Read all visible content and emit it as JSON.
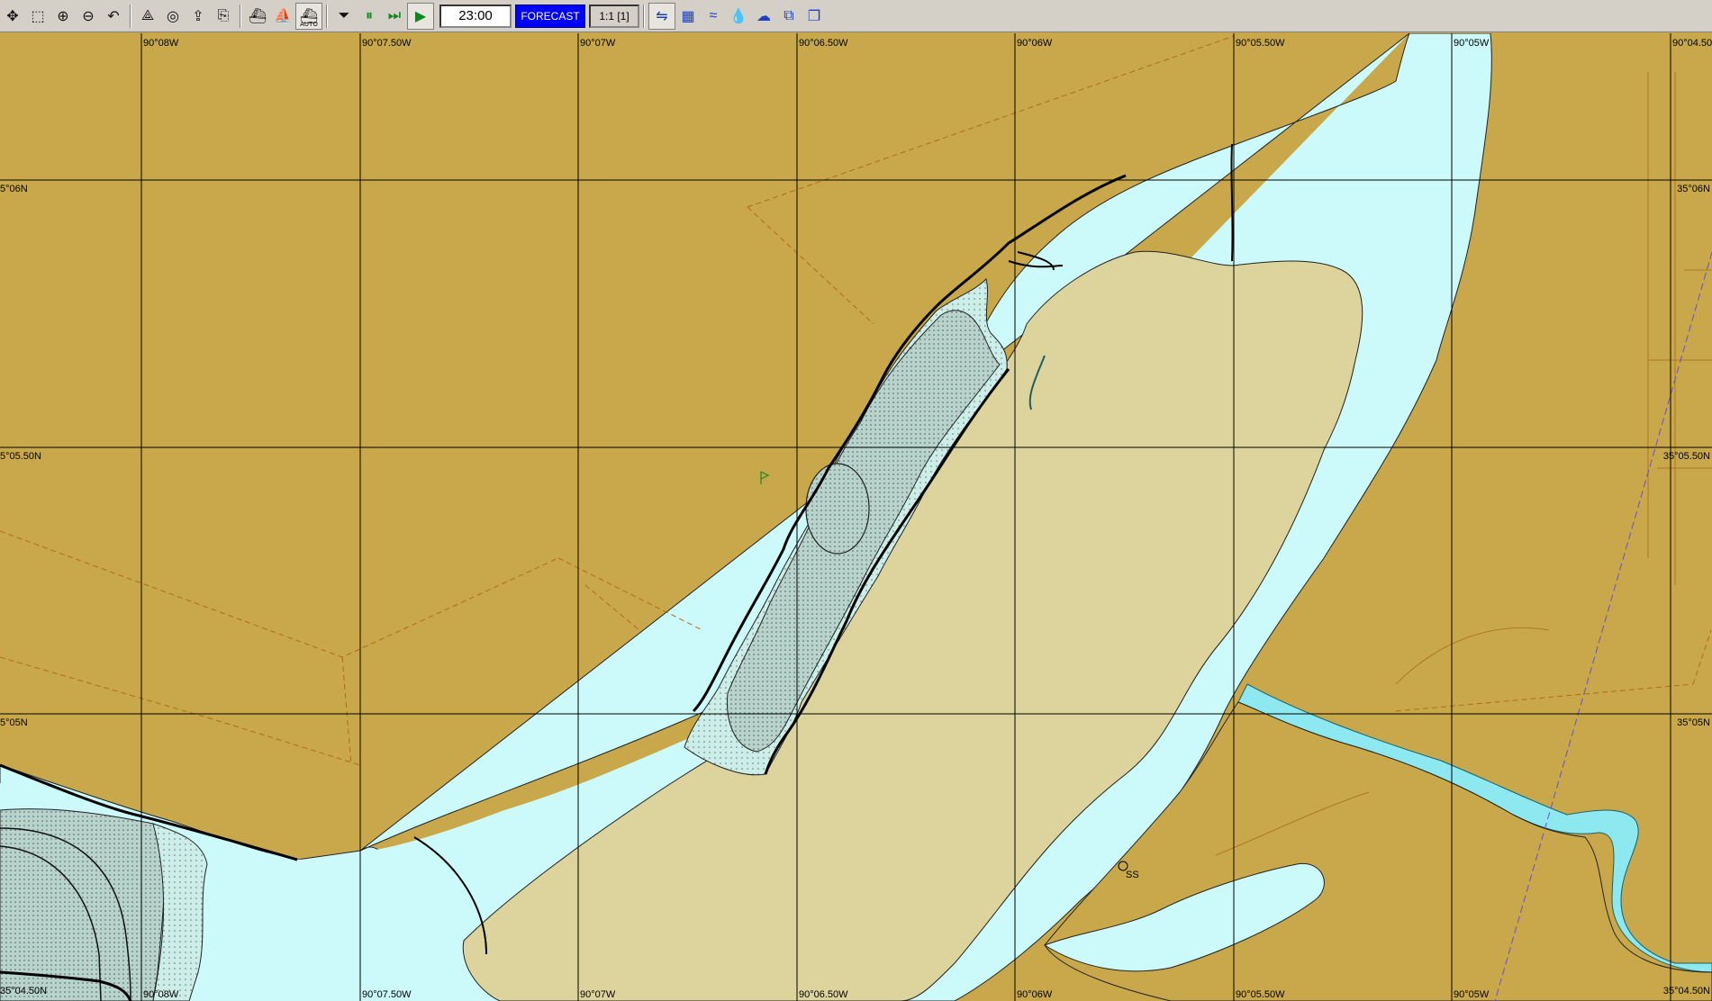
{
  "toolbar": {
    "time": "23:00",
    "forecast_label": "FORECAST",
    "scale_label": "1:1 [1]",
    "auto_label": "AUTO",
    "icons": [
      "pan-icon",
      "zoom-box-icon",
      "zoom-in-icon",
      "zoom-out-icon",
      "undo-icon",
      "route-icon",
      "target-icon",
      "export-icon",
      "import-icon",
      "ship-icon",
      "ship-small-icon",
      "ship-auto-icon",
      "step-down-icon",
      "pause-icon",
      "fast-forward-icon",
      "play-icon",
      "tide-icon",
      "grid-icon",
      "current-icon",
      "water-icon",
      "weather-icon",
      "layers-icon",
      "windows-icon"
    ]
  },
  "chart": {
    "longitude_labels_top": [
      "90°08W",
      "90°07.50W",
      "90°07W",
      "90°06.50W",
      "90°06W",
      "90°05.50W",
      "90°05W",
      "90°04.50"
    ],
    "longitude_labels_bottom": [
      "90°08W",
      "90°07.50W",
      "90°07W",
      "90°06.50W",
      "90°06W",
      "90°05.50W",
      "90°05W"
    ],
    "latitude_labels_left": [
      "5°06N",
      "5°05.50N",
      "5°05N",
      "35°04.50N"
    ],
    "latitude_labels_right": [
      "35°06N",
      "35°05.50N",
      "35°05N",
      "35°04.50N"
    ],
    "feature_label": "SS",
    "colors": {
      "land": "#c8a84b",
      "water": "#ccfafa",
      "sandbar": "#ddd39c",
      "channel": "#8ee8ef"
    }
  }
}
